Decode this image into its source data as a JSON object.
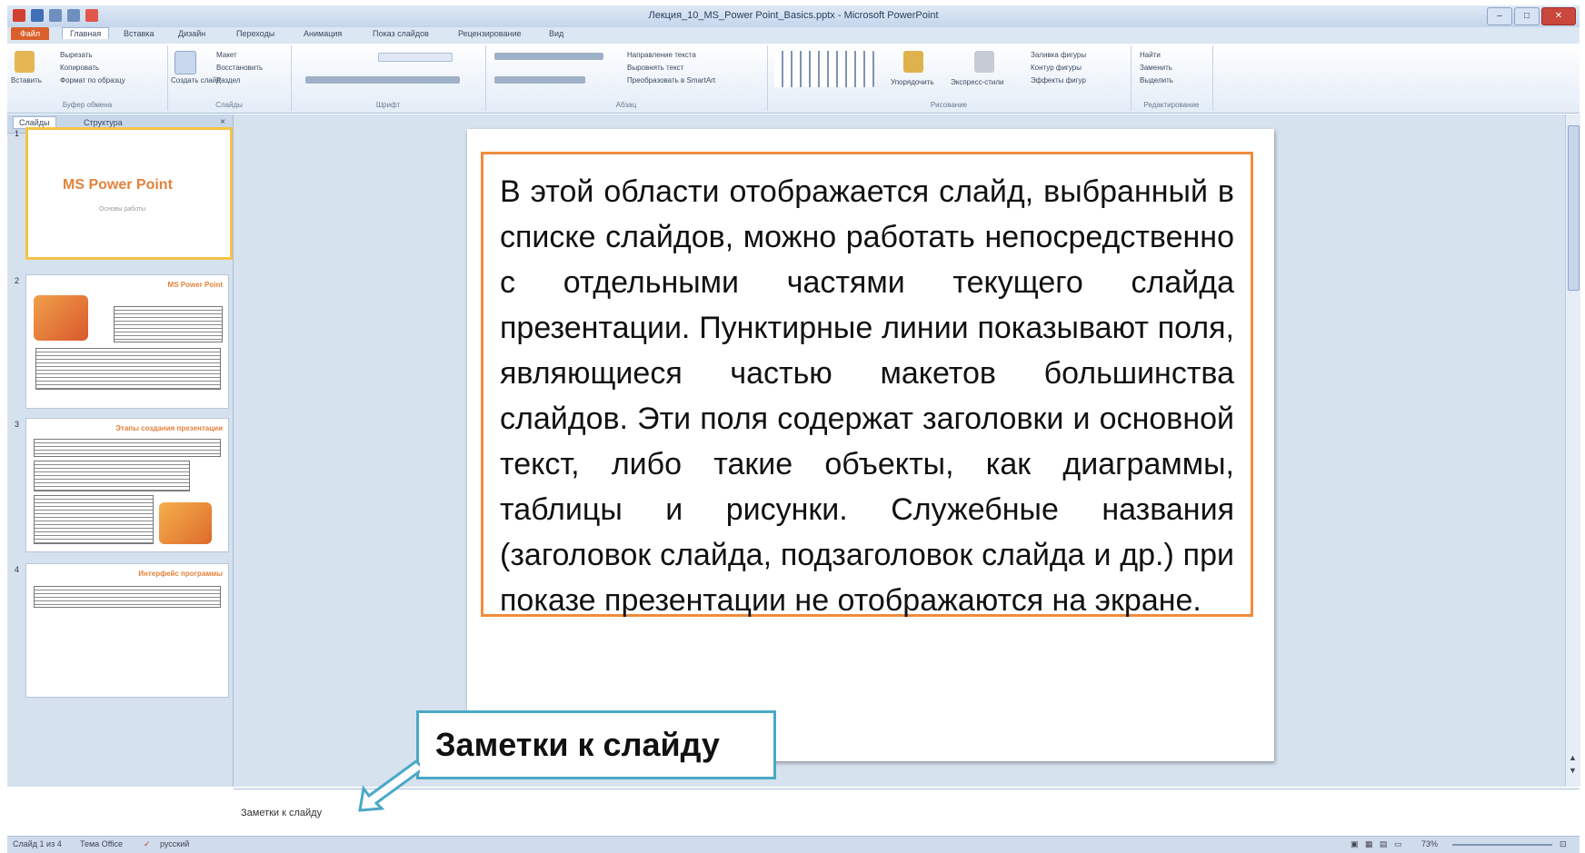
{
  "window": {
    "title": "Лекция_10_MS_Power Point_Basics.pptx - Microsoft PowerPoint",
    "controls": [
      "–",
      "□",
      "✕"
    ]
  },
  "ribbon_tabs": [
    "Файл",
    "Главная",
    "Вставка",
    "Дизайн",
    "Переходы",
    "Анимация",
    "Показ слайдов",
    "Рецензирование",
    "Вид"
  ],
  "ribbon": {
    "clipboard": {
      "paste": "Вставить",
      "cut": "Вырезать",
      "copy": "Копировать",
      "format_painter": "Формат по образцу",
      "group": "Буфер обмена"
    },
    "slides": {
      "new_slide": "Создать слайд",
      "layout": "Макет",
      "reset": "Восстановить",
      "section": "Раздел",
      "group": "Слайды"
    },
    "font": {
      "group": "Шрифт"
    },
    "paragraph": {
      "text_direction": "Направление текста",
      "align_text": "Выровнять текст",
      "smartart": "Преобразовать в SmartArt",
      "group": "Абзац"
    },
    "drawing": {
      "arrange": "Упорядочить",
      "quick_styles": "Экспресс-стили",
      "fill": "Заливка фигуры",
      "outline": "Контур фигуры",
      "effects": "Эффекты фигур",
      "group": "Рисование"
    },
    "editing": {
      "find": "Найти",
      "replace": "Заменить",
      "select": "Выделить",
      "group": "Редактирование"
    }
  },
  "left_pane": {
    "tabs": [
      "Слайды",
      "Структура"
    ],
    "close": "×",
    "slides": [
      {
        "num": "1",
        "title": "MS Power Point",
        "subtitle": "Основы работы"
      },
      {
        "num": "2",
        "title": "MS Power Point"
      },
      {
        "num": "3",
        "title": "Этапы создания презентации"
      },
      {
        "num": "4",
        "title": "Интерфейс программы"
      }
    ]
  },
  "slide": {
    "text": "В этой области отображается слайд, выбранный в списке слайдов, можно работать непосредственно с отдельными частями текущего слайда презентации. Пунктирные линии показывают поля, являющиеся частью макетов большинства слайдов. Эти поля содержат заголовки и основной текст, либо такие объекты, как диаграммы, таблицы и рисунки. Служебные названия (заголовок слайда, подзаголовок слайда и др.) при показе презентации не отображаются на экране."
  },
  "callout": {
    "label": "Заметки к слайду"
  },
  "notes": {
    "text": "Заметки к слайду"
  },
  "status": {
    "slide_info": "Слайд 1 из 4",
    "theme": "Тема Office",
    "language": "русский",
    "zoom": "73%"
  }
}
